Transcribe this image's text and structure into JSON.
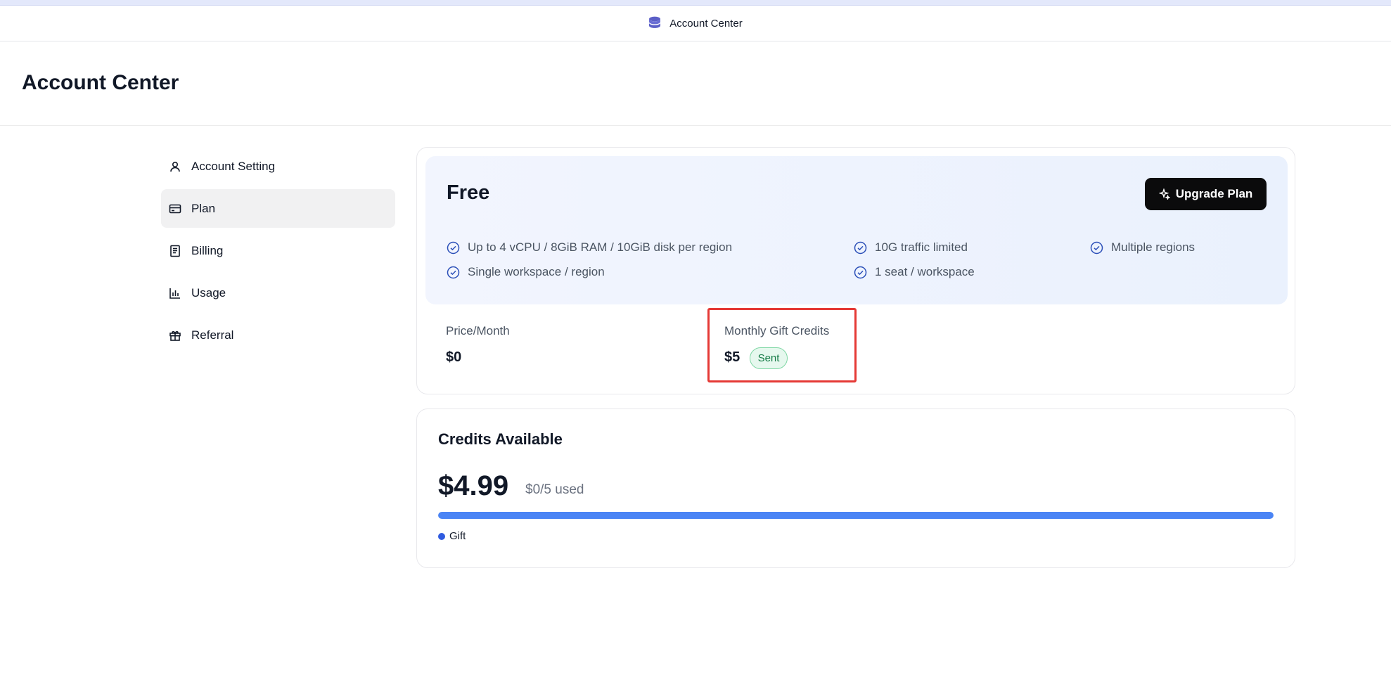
{
  "app": {
    "title": "Account Center"
  },
  "page": {
    "title": "Account Center"
  },
  "sidebar": {
    "items": [
      {
        "label": "Account Setting",
        "icon": "user-icon"
      },
      {
        "label": "Plan",
        "icon": "credit-card-icon",
        "active": true
      },
      {
        "label": "Billing",
        "icon": "receipt-icon"
      },
      {
        "label": "Usage",
        "icon": "bar-chart-icon"
      },
      {
        "label": "Referral",
        "icon": "gift-icon"
      }
    ]
  },
  "plan": {
    "name": "Free",
    "upgrade_label": "Upgrade Plan",
    "features": [
      "Up to 4 vCPU / 8GiB RAM / 10GiB disk per region",
      "10G traffic limited",
      "Multiple regions",
      "Single workspace / region",
      "1 seat / workspace"
    ],
    "price_label": "Price/Month",
    "price_value": "$0",
    "gift_label": "Monthly Gift Credits",
    "gift_value": "$5",
    "gift_status": "Sent"
  },
  "credits": {
    "title": "Credits Available",
    "amount": "$4.99",
    "used": "$0/5 used",
    "progress_fraction": 1.0,
    "legend_label": "Gift"
  },
  "colors": {
    "accent": "#4a84f5",
    "highlight_border": "#e53935",
    "badge_bg": "#e6f8ee",
    "badge_text": "#147a45"
  }
}
